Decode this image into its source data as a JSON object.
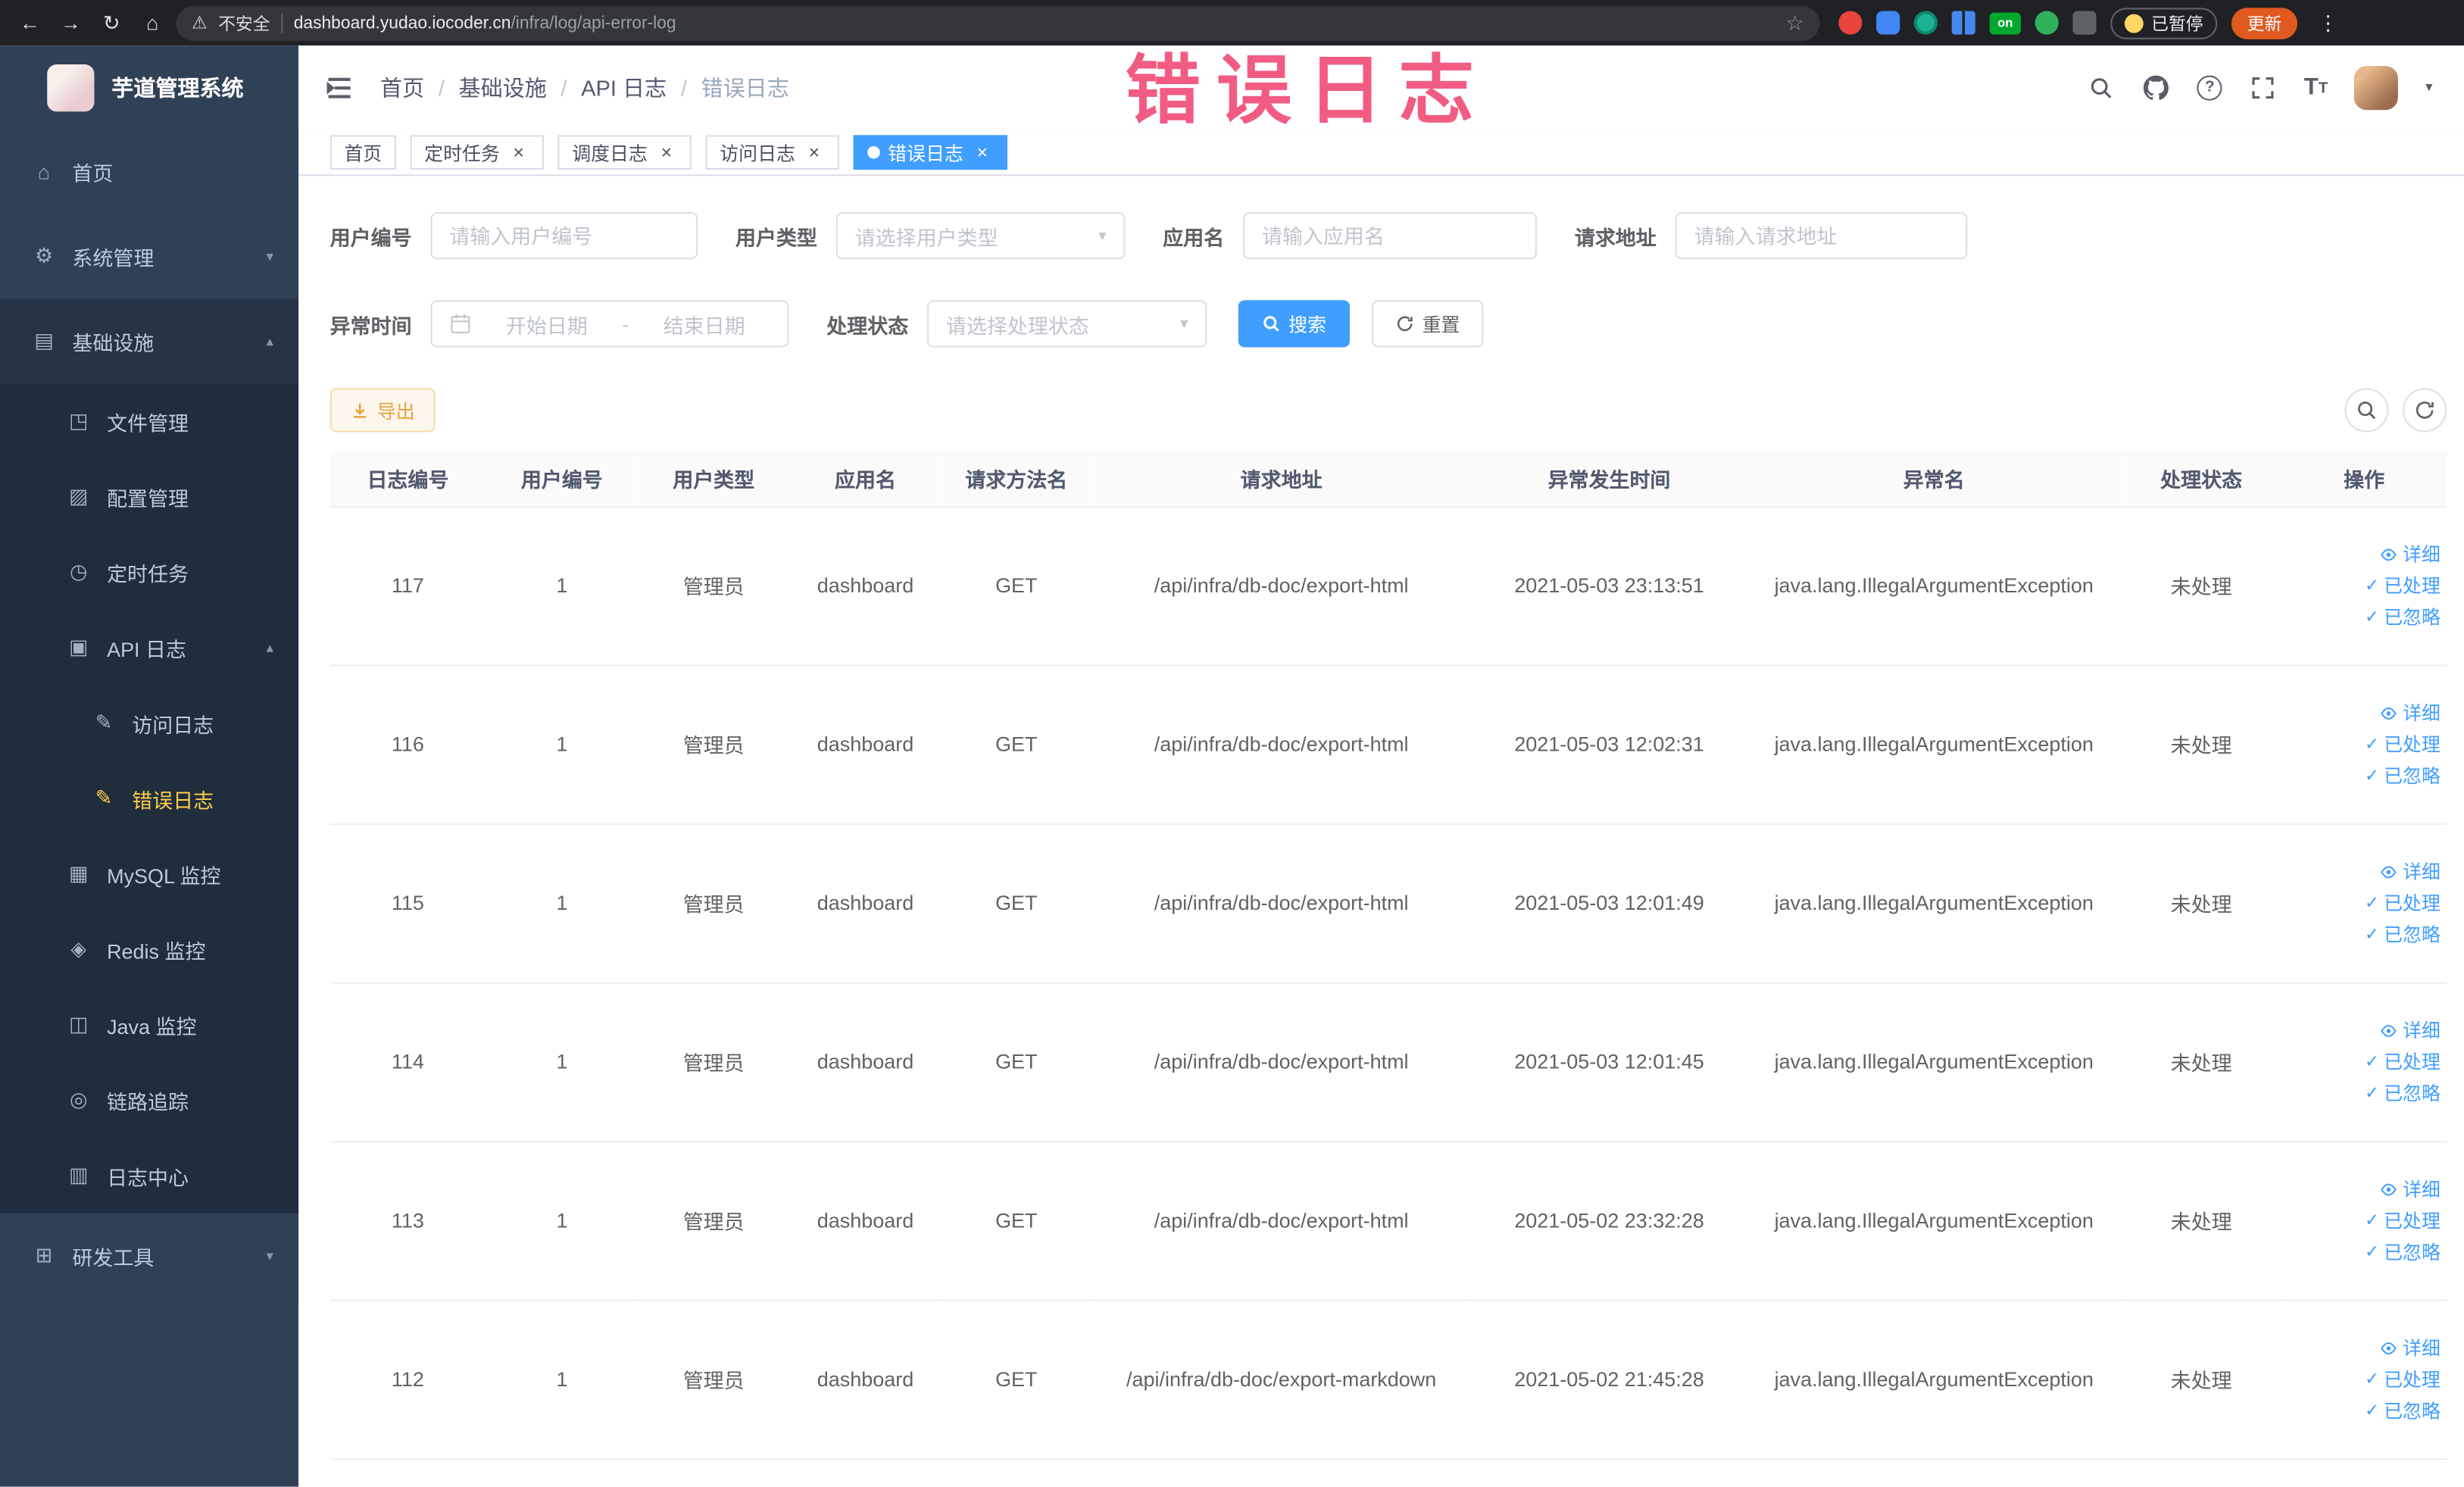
{
  "annotation": {
    "text": "错误日志",
    "color": "#f2547d"
  },
  "browser": {
    "security_label": "不安全",
    "url_domain": "dashboard.yudao.iocoder.cn",
    "url_path": "/infra/log/api-error-log",
    "extension_on_label": "on",
    "paused_label": "已暂停",
    "update_label": "更新"
  },
  "sidebar": {
    "logo_title": "芋道管理系统",
    "items": [
      {
        "label": "首页",
        "icon": "home-icon",
        "level": 1,
        "arrow": "",
        "open": false,
        "active": false
      },
      {
        "label": "系统管理",
        "icon": "gear-icon",
        "level": 1,
        "arrow": "down",
        "open": false,
        "active": false
      },
      {
        "label": "基础设施",
        "icon": "infra-icon",
        "level": 1,
        "arrow": "up",
        "open": true,
        "active": false
      },
      {
        "label": "文件管理",
        "icon": "file-manage-icon",
        "level": 2,
        "arrow": "",
        "open": false,
        "active": false
      },
      {
        "label": "配置管理",
        "icon": "config-manage-icon",
        "level": 2,
        "arrow": "",
        "open": false,
        "active": false
      },
      {
        "label": "定时任务",
        "icon": "timer-task-icon",
        "level": 2,
        "arrow": "",
        "open": false,
        "active": false
      },
      {
        "label": "API 日志",
        "icon": "api-log-icon",
        "level": 2,
        "arrow": "up",
        "open": true,
        "active": false
      },
      {
        "label": "访问日志",
        "icon": "access-log-icon",
        "level": 3,
        "arrow": "",
        "open": false,
        "active": false
      },
      {
        "label": "错误日志",
        "icon": "error-log-icon",
        "level": 3,
        "arrow": "",
        "open": false,
        "active": true
      },
      {
        "label": "MySQL 监控",
        "icon": "mysql-monitor-icon",
        "level": 2,
        "arrow": "",
        "open": false,
        "active": false
      },
      {
        "label": "Redis 监控",
        "icon": "redis-monitor-icon",
        "level": 2,
        "arrow": "",
        "open": false,
        "active": false
      },
      {
        "label": "Java 监控",
        "icon": "java-monitor-icon",
        "level": 2,
        "arrow": "",
        "open": false,
        "active": false
      },
      {
        "label": "链路追踪",
        "icon": "trace-icon",
        "level": 2,
        "arrow": "",
        "open": false,
        "active": false
      },
      {
        "label": "日志中心",
        "icon": "log-center-icon",
        "level": 2,
        "arrow": "",
        "open": false,
        "active": false
      },
      {
        "label": "研发工具",
        "icon": "devtools-icon",
        "level": 1,
        "arrow": "down",
        "open": false,
        "active": false
      }
    ]
  },
  "header": {
    "breadcrumb": [
      {
        "label": "首页",
        "current": false
      },
      {
        "label": "基础设施",
        "current": false
      },
      {
        "label": "API 日志",
        "current": false
      },
      {
        "label": "错误日志",
        "current": true
      }
    ]
  },
  "tabs": [
    {
      "label": "首页",
      "closable": false,
      "active": false
    },
    {
      "label": "定时任务",
      "closable": true,
      "active": false
    },
    {
      "label": "调度日志",
      "closable": true,
      "active": false
    },
    {
      "label": "访问日志",
      "closable": true,
      "active": false
    },
    {
      "label": "错误日志",
      "closable": true,
      "active": true
    }
  ],
  "filters": {
    "user_id": {
      "label": "用户编号",
      "placeholder": "请输入用户编号"
    },
    "user_type": {
      "label": "用户类型",
      "placeholder": "请选择用户类型"
    },
    "app_name": {
      "label": "应用名",
      "placeholder": "请输入应用名"
    },
    "request_url": {
      "label": "请求地址",
      "placeholder": "请输入请求地址"
    },
    "exception_time": {
      "label": "异常时间",
      "start_placeholder": "开始日期",
      "separator": "-",
      "end_placeholder": "结束日期"
    },
    "process_status": {
      "label": "处理状态",
      "placeholder": "请选择处理状态"
    },
    "search_label": "搜索",
    "reset_label": "重置"
  },
  "toolbar": {
    "export_label": "导出"
  },
  "table": {
    "columns": [
      "日志编号",
      "用户编号",
      "用户类型",
      "应用名",
      "请求方法名",
      "请求地址",
      "异常发生时间",
      "异常名",
      "处理状态",
      "操作"
    ],
    "action_labels": {
      "detail": "详细",
      "process": "已处理",
      "ignore": "已忽略"
    },
    "rows": [
      {
        "log_id": "117",
        "user_id": "1",
        "user_type": "管理员",
        "app_name": "dashboard",
        "method": "GET",
        "url": "/api/infra/db-doc/export-html",
        "time": "2021-05-03 23:13:51",
        "exception": "java.lang.IllegalArgumentException",
        "status": "未处理"
      },
      {
        "log_id": "116",
        "user_id": "1",
        "user_type": "管理员",
        "app_name": "dashboard",
        "method": "GET",
        "url": "/api/infra/db-doc/export-html",
        "time": "2021-05-03 12:02:31",
        "exception": "java.lang.IllegalArgumentException",
        "status": "未处理"
      },
      {
        "log_id": "115",
        "user_id": "1",
        "user_type": "管理员",
        "app_name": "dashboard",
        "method": "GET",
        "url": "/api/infra/db-doc/export-html",
        "time": "2021-05-03 12:01:49",
        "exception": "java.lang.IllegalArgumentException",
        "status": "未处理"
      },
      {
        "log_id": "114",
        "user_id": "1",
        "user_type": "管理员",
        "app_name": "dashboard",
        "method": "GET",
        "url": "/api/infra/db-doc/export-html",
        "time": "2021-05-03 12:01:45",
        "exception": "java.lang.IllegalArgumentException",
        "status": "未处理"
      },
      {
        "log_id": "113",
        "user_id": "1",
        "user_type": "管理员",
        "app_name": "dashboard",
        "method": "GET",
        "url": "/api/infra/db-doc/export-html",
        "time": "2021-05-02 23:32:28",
        "exception": "java.lang.IllegalArgumentException",
        "status": "未处理"
      },
      {
        "log_id": "112",
        "user_id": "1",
        "user_type": "管理员",
        "app_name": "dashboard",
        "method": "GET",
        "url": "/api/infra/db-doc/export-markdown",
        "time": "2021-05-02 21:45:28",
        "exception": "java.lang.IllegalArgumentException",
        "status": "未处理"
      }
    ]
  }
}
